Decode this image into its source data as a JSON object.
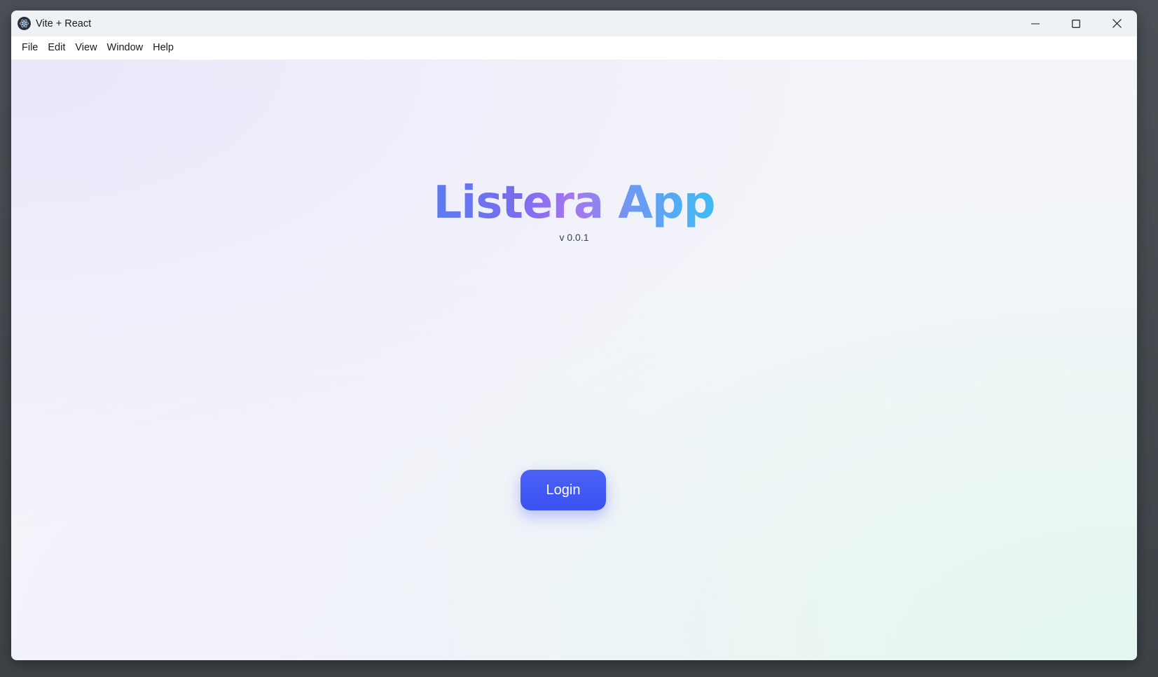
{
  "window": {
    "title": "Vite + React",
    "icon": "electron-icon",
    "controls": [
      "minimize-icon",
      "maximize-icon",
      "close-icon"
    ]
  },
  "menubar": {
    "items": [
      "File",
      "Edit",
      "View",
      "Window",
      "Help"
    ]
  },
  "main": {
    "app_title": "Listera App",
    "version": "v 0.0.1",
    "login_label": "Login"
  },
  "colors": {
    "accent": "#4059F4",
    "title_gradient": [
      "#5B7CF0",
      "#A478EE",
      "#3FBCF2"
    ]
  }
}
